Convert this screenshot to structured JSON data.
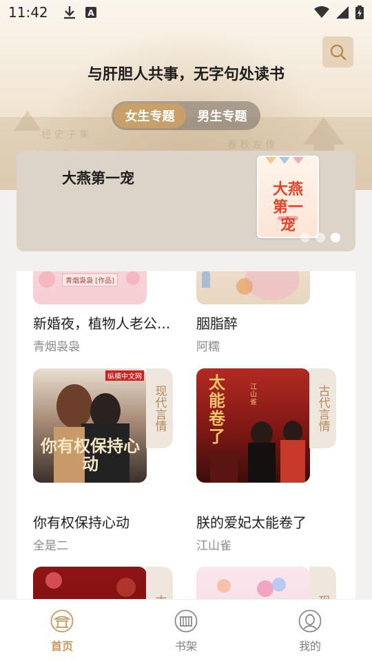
{
  "status_bar": {
    "time": "11:42",
    "left_icons": [
      "download-icon",
      "font-a-icon"
    ],
    "right_icons": [
      "wifi-icon",
      "signal-icon",
      "battery-icon"
    ]
  },
  "header": {
    "slogan": "与肝胆人共事，无字句处读书",
    "search_icon": "search-icon",
    "topic_tabs": [
      {
        "label": "女生专题",
        "active": true
      },
      {
        "label": "男生专题",
        "active": false
      }
    ]
  },
  "banner": {
    "title": "大燕第一宠",
    "cover_text": "大燕第一宠",
    "dots": [
      false,
      false,
      true
    ]
  },
  "books": [
    {
      "title": "新婚夜，植物人老公...",
      "author": "青烟袅袅",
      "genre": "",
      "cover_caption": "青烟袅袅 [作品]"
    },
    {
      "title": "胭脂醉",
      "author": "阿糯",
      "genre": "",
      "cover_caption": ""
    },
    {
      "title": "你有权保持心动",
      "author": "全是二",
      "genre": "现代言情",
      "cover_caption": "你有权保持心动",
      "cover_badge": "纵横中文网"
    },
    {
      "title": "朕的爱妃太能卷了",
      "author": "江山雀",
      "genre": "古代言情",
      "cover_caption": "太能卷了",
      "cover_badge": "江山雀"
    },
    {
      "title": "",
      "author": "",
      "genre": "古代",
      "cover_caption": ""
    },
    {
      "title": "",
      "author": "",
      "genre": "现代",
      "cover_caption": ""
    }
  ],
  "bottom_nav": [
    {
      "label": "首页",
      "icon": "home-pavilion-icon",
      "active": true
    },
    {
      "label": "书架",
      "icon": "bookshelf-icon",
      "active": false
    },
    {
      "label": "我的",
      "icon": "profile-icon",
      "active": false
    }
  ],
  "colors": {
    "accent": "#c9975c",
    "tab_active": "#c9a06a",
    "genre_tag_bg": "#efe7de",
    "genre_tag_text": "#b3895f"
  }
}
